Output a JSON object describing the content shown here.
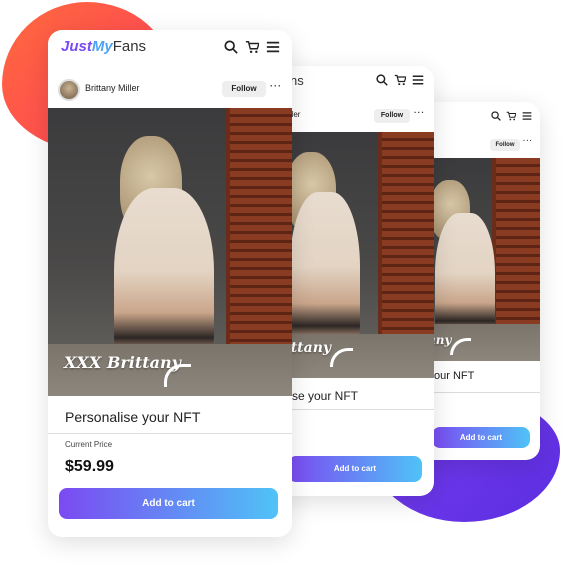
{
  "header": {
    "logo_just": "Just",
    "logo_my": "My",
    "logo_fans": "Fans",
    "logo_fans_partial": "ns"
  },
  "post": {
    "username": "Brittany Miller",
    "username_partial": "iller",
    "follow_label": "Follow",
    "more_label": "···",
    "signature": "XXX Brittany",
    "signature_partial": "rittany"
  },
  "product": {
    "title": "Personalise your NFT",
    "title_partial_mid": "se your NFT",
    "title_partial_back": "our NFT",
    "price_label": "Current Price",
    "price": "$59.99",
    "add_to_cart": "Add to cart"
  },
  "icons": {
    "search": "search-icon",
    "cart": "cart-icon",
    "menu": "menu-icon"
  },
  "colors": {
    "accent_purple": "#7b4af2",
    "accent_blue": "#4fc3f7",
    "blob_orange": "#ff5a47",
    "blob_purple": "#6a35eb"
  }
}
